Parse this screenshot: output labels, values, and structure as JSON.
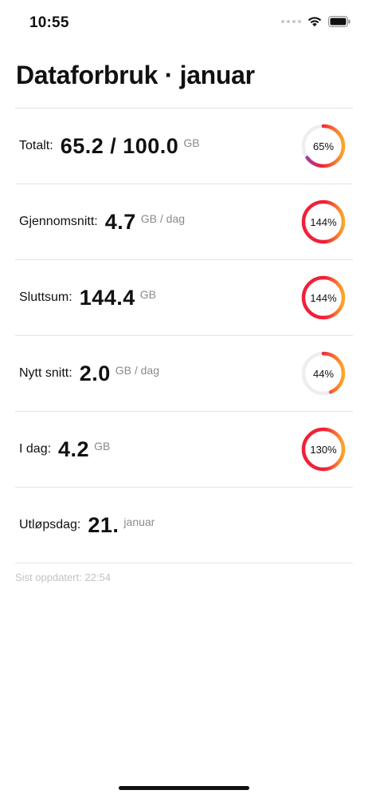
{
  "status_bar": {
    "time": "10:55"
  },
  "page": {
    "title": "Dataforbruk · januar"
  },
  "colors": {
    "ring_track": "#eeeeee",
    "ring_purple": "#8e44c4",
    "ring_red": "#f0203a",
    "ring_orange": "#fca62a",
    "divider": "#e4e4e4",
    "muted": "#8a8a8e"
  },
  "rows": [
    {
      "label": "Totalt:",
      "value": "65.2 / 100.0",
      "unit": "GB",
      "ring_percent": 65,
      "ring_label": "65%"
    },
    {
      "label": "Gjennomsnitt:",
      "value": "4.7",
      "unit": "GB / dag",
      "ring_percent": 144,
      "ring_label": "144%"
    },
    {
      "label": "Sluttsum:",
      "value": "144.4",
      "unit": "GB",
      "ring_percent": 144,
      "ring_label": "144%"
    },
    {
      "label": "Nytt snitt:",
      "value": "2.0",
      "unit": "GB / dag",
      "ring_percent": 44,
      "ring_label": "44%"
    },
    {
      "label": "I dag:",
      "value": "4.2",
      "unit": "GB",
      "ring_percent": 130,
      "ring_label": "130%"
    },
    {
      "label": "Utløpsdag:",
      "value": "21.",
      "unit": "januar"
    }
  ],
  "footer": {
    "updated": "Sist oppdatert: 22:54"
  }
}
